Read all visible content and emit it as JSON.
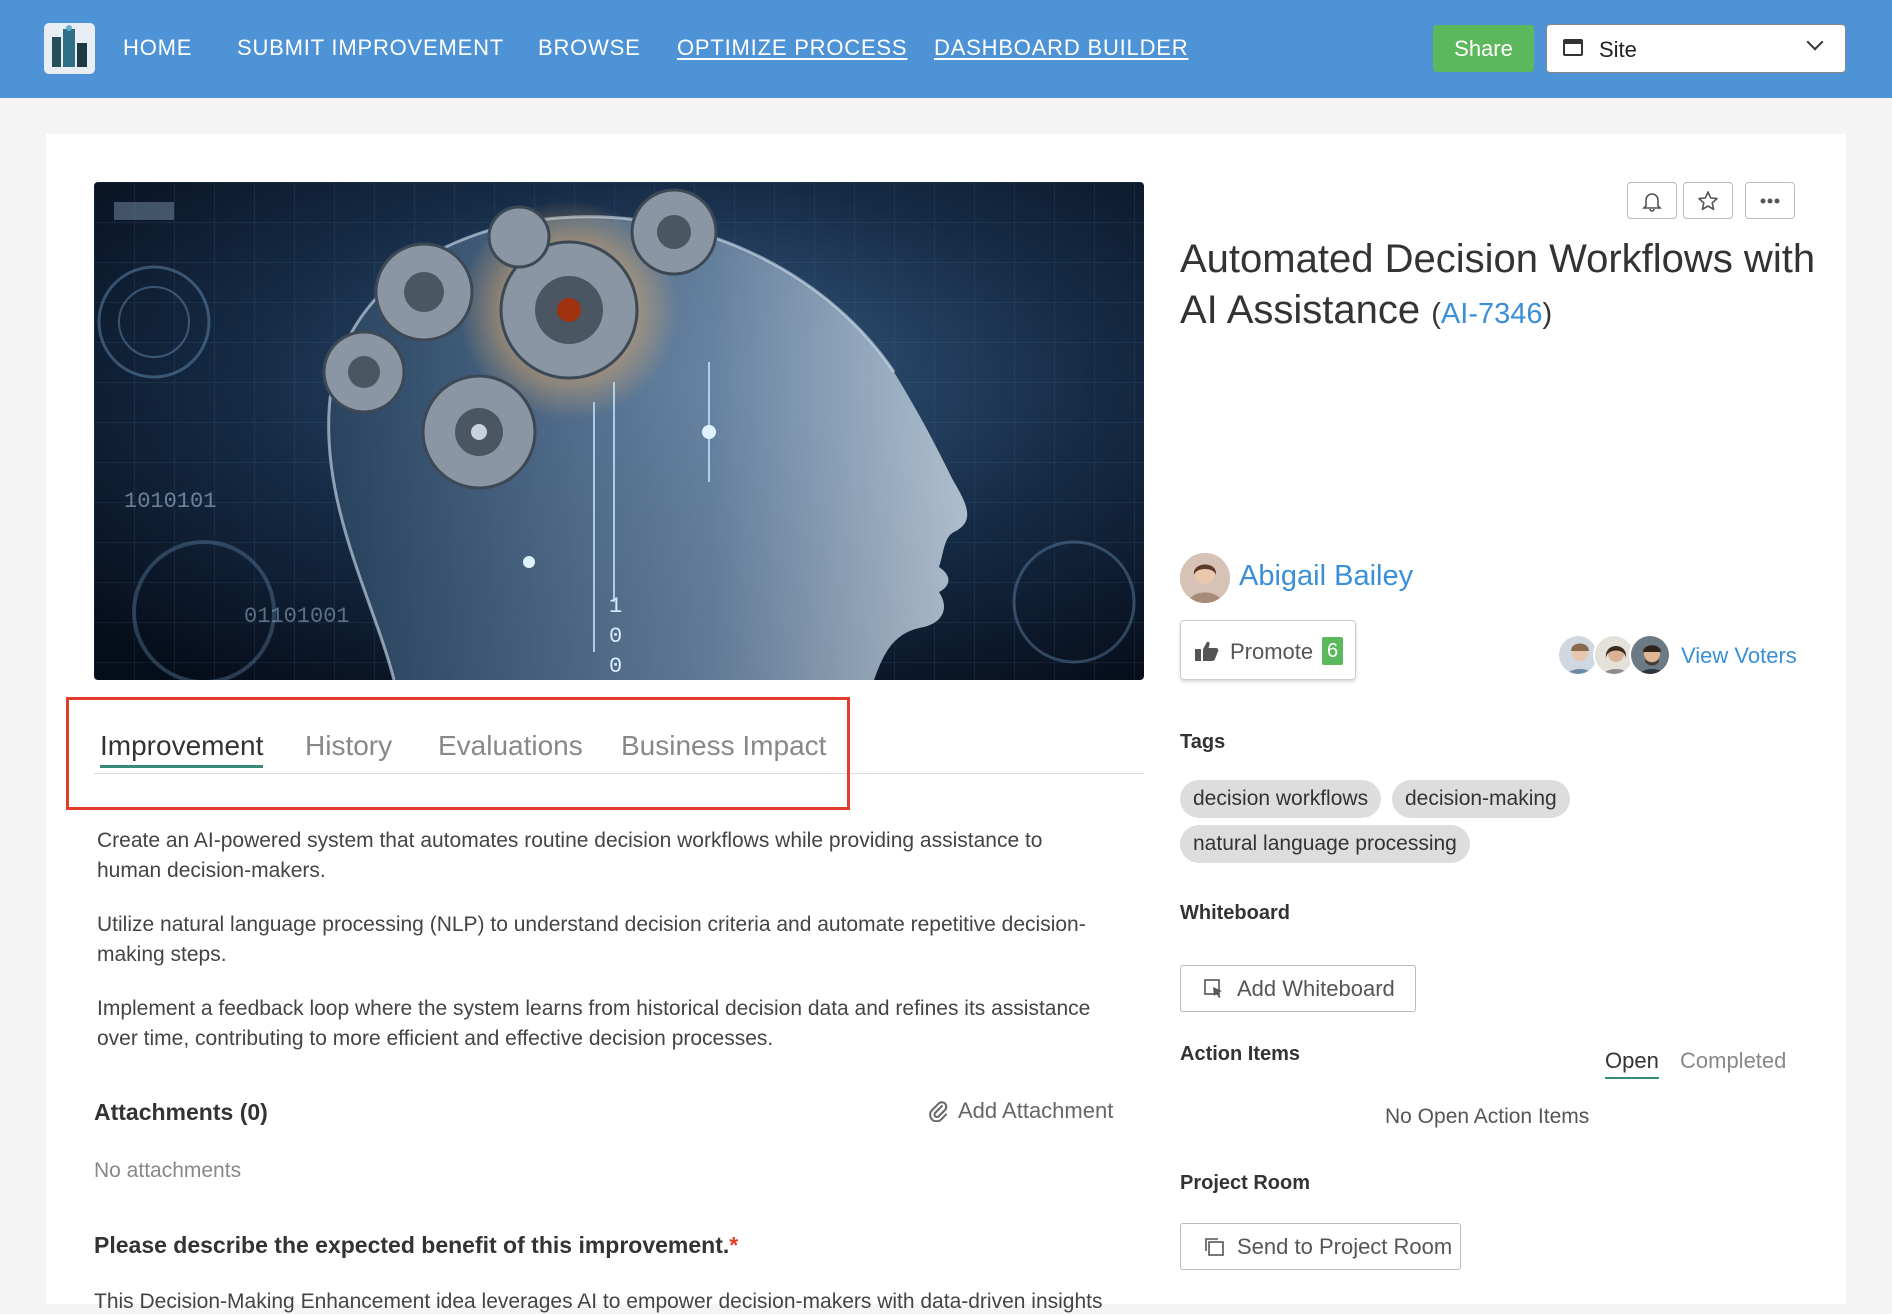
{
  "nav": {
    "links": [
      "HOME",
      "SUBMIT IMPROVEMENT",
      "BROWSE",
      "OPTIMIZE PROCESS",
      "DASHBOARD BUILDER"
    ],
    "share_label": "Share",
    "site_label": "Site"
  },
  "hero": {
    "icon": "ai-head-with-gears-image"
  },
  "tabs": [
    "Improvement",
    "History",
    "Evaluations",
    "Business Impact"
  ],
  "active_tab": "Improvement",
  "description": [
    "Create an AI-powered system that automates routine decision workflows while providing assistance to human decision-makers.",
    "Utilize natural language processing (NLP) to understand decision criteria and automate repetitive decision-making steps.",
    "Implement a feedback loop where the system learns from historical decision data and refines its assistance over time, contributing to more efficient and effective decision processes."
  ],
  "attachments": {
    "heading": "Attachments (0)",
    "empty": "No attachments",
    "add_label": "Add Attachment"
  },
  "benefit": {
    "question": "Please describe the expected benefit of this improvement.",
    "required_mark": "*",
    "answer_partial": "This Decision-Making Enhancement idea leverages AI to empower decision-makers with data-driven insights"
  },
  "idea": {
    "title": "Automated Decision Workflows with AI Assistance",
    "code_open": "(",
    "code": "AI-7346",
    "code_close": ")"
  },
  "author": {
    "name": "Abigail Bailey"
  },
  "promote": {
    "label": "Promote",
    "count": "6"
  },
  "voters": {
    "link_label": "View Voters"
  },
  "tags_section": {
    "heading": "Tags",
    "items": [
      "decision workflows",
      "decision-making",
      "natural language processing"
    ]
  },
  "whiteboard": {
    "heading": "Whiteboard",
    "button": "Add Whiteboard"
  },
  "action_items": {
    "heading": "Action Items",
    "tabs": [
      "Open",
      "Completed"
    ],
    "active": "Open",
    "empty": "No Open Action Items"
  },
  "project_room": {
    "heading": "Project Room",
    "button": "Send to Project Room"
  },
  "colors": {
    "navbar": "#4e93d6",
    "share": "#5cb85c",
    "link": "#3a8fd8",
    "highlight": "#e23c2a",
    "tab_underline": "#3a8a7a"
  }
}
